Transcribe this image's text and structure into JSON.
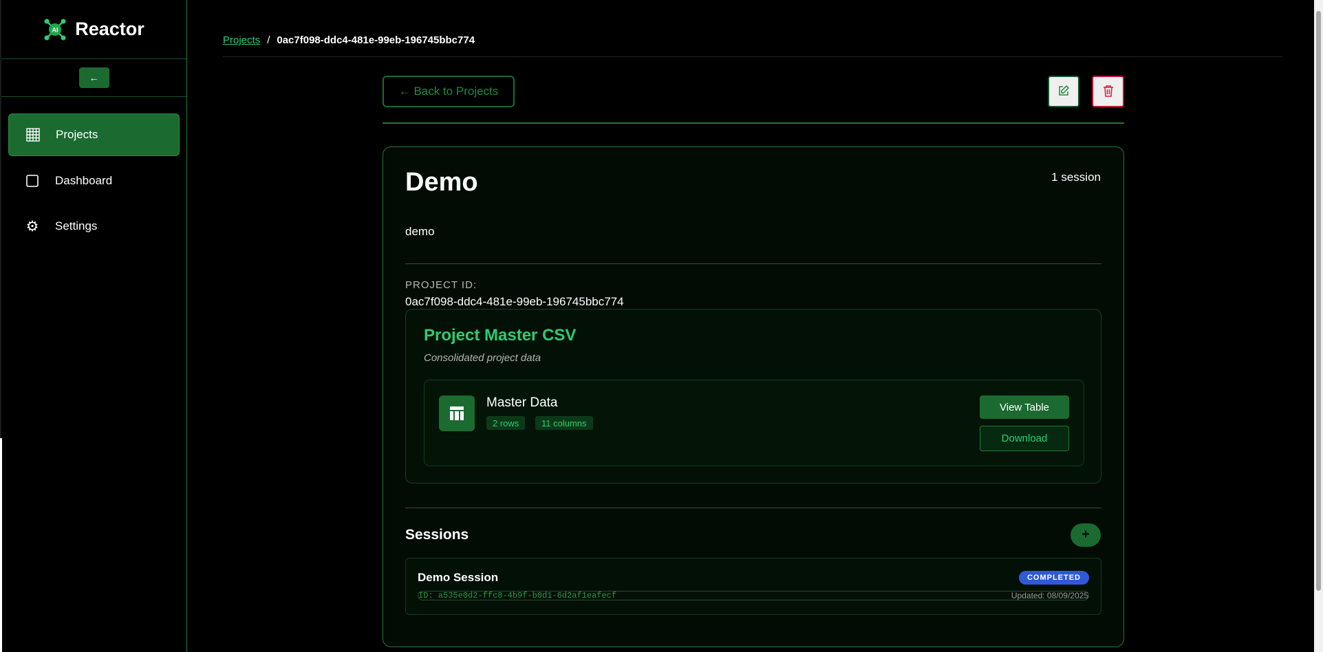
{
  "app": {
    "name": "Reactor",
    "logo_text": "AI"
  },
  "sidebar": {
    "collapse_label": "←",
    "items": [
      {
        "label": "Projects",
        "icon": "grid-icon",
        "active": true
      },
      {
        "label": "Dashboard",
        "icon": "square-icon",
        "active": false
      },
      {
        "label": "Settings",
        "icon": "gear-icon",
        "active": false
      }
    ]
  },
  "breadcrumb": {
    "parent": "Projects",
    "separator": "/",
    "current": "0ac7f098-ddc4-481e-99eb-196745bbc774"
  },
  "toolbar": {
    "back_label": "← Back to Projects",
    "edit_icon": "edit-icon",
    "delete_icon": "trash-icon"
  },
  "project": {
    "title": "Demo",
    "session_count": "1 session",
    "description": "demo",
    "id_label": "PROJECT ID:",
    "id": "0ac7f098-ddc4-481e-99eb-196745bbc774"
  },
  "master_csv": {
    "title": "Project Master CSV",
    "subtitle": "Consolidated project data",
    "dataset_name": "Master Data",
    "rows": "2 rows",
    "columns": "11 columns",
    "view_label": "View Table",
    "download_label": "Download"
  },
  "sessions": {
    "title": "Sessions",
    "add_label": "+",
    "items": [
      {
        "name": "Demo Session",
        "status": "COMPLETED",
        "id": "ID: a535e0d2-ffc8-4b9f-b0d1-6d2af1eafecf",
        "updated": "Updated: 08/09/2025"
      }
    ]
  },
  "colors": {
    "accent": "#1b6b30",
    "accent_text": "#2ecc71",
    "danger": "#c0102e",
    "status_completed": "#2f5ad6"
  }
}
